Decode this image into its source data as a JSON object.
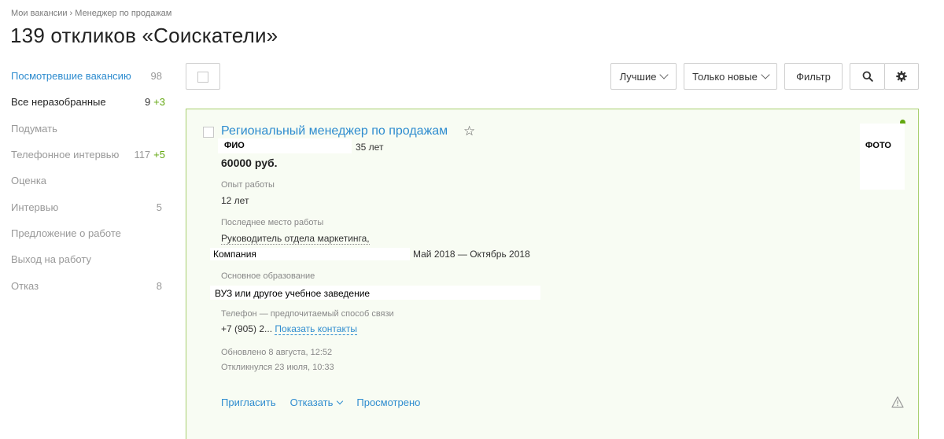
{
  "breadcrumb": {
    "parent": "Мои вакансии",
    "separator": "›",
    "current": "Менеджер по продажам"
  },
  "page_title": "139 откликов «Соискатели»",
  "sidebar": {
    "items": [
      {
        "label": "Посмотревшие вакансию",
        "count": "98",
        "plus": ""
      },
      {
        "label": "Все неразобранные",
        "count": "9",
        "plus": "+3"
      },
      {
        "label": "Подумать",
        "count": "",
        "plus": ""
      },
      {
        "label": "Телефонное интервью",
        "count": "117",
        "plus": "+5"
      },
      {
        "label": "Оценка",
        "count": "",
        "plus": ""
      },
      {
        "label": "Интервью",
        "count": "5",
        "plus": ""
      },
      {
        "label": "Предложение о работе",
        "count": "",
        "plus": ""
      },
      {
        "label": "Выход на работу",
        "count": "",
        "plus": ""
      },
      {
        "label": "Отказ",
        "count": "8",
        "plus": ""
      }
    ]
  },
  "toolbar": {
    "sort_label": "Лучшие",
    "new_filter_label": "Только новые",
    "filter_label": "Фильтр"
  },
  "card": {
    "title": "Региональный менеджер по продажам",
    "fio": "ФИО",
    "age": "35 лет",
    "salary": "60000 руб.",
    "photo": "ФОТО",
    "experience_label": "Опыт работы",
    "experience_value": "12 лет",
    "last_job_label": "Последнее место работы",
    "last_job_position": "Руководитель отдела маркетинга,",
    "company": "Компания",
    "period": "Май 2018 — Октябрь 2018",
    "education_label": "Основное образование",
    "education_value": "ВУЗ или другое учебное заведение",
    "phone_label": "Телефон — предпочитаемый способ связи",
    "phone_value": "+7 (905) 2...",
    "show_contacts": "Показать контакты",
    "updated": "Обновлено 8 августа, 12:52",
    "responded": "Откликнулся 23 июля, 10:33",
    "actions": {
      "invite": "Пригласить",
      "reject": "Отказать",
      "viewed": "Просмотрено"
    }
  },
  "colors": {
    "link": "#2e8ccf",
    "accent_green": "#62a70f",
    "card_border": "#a8cf6f",
    "card_bg": "#f8fcf3"
  }
}
